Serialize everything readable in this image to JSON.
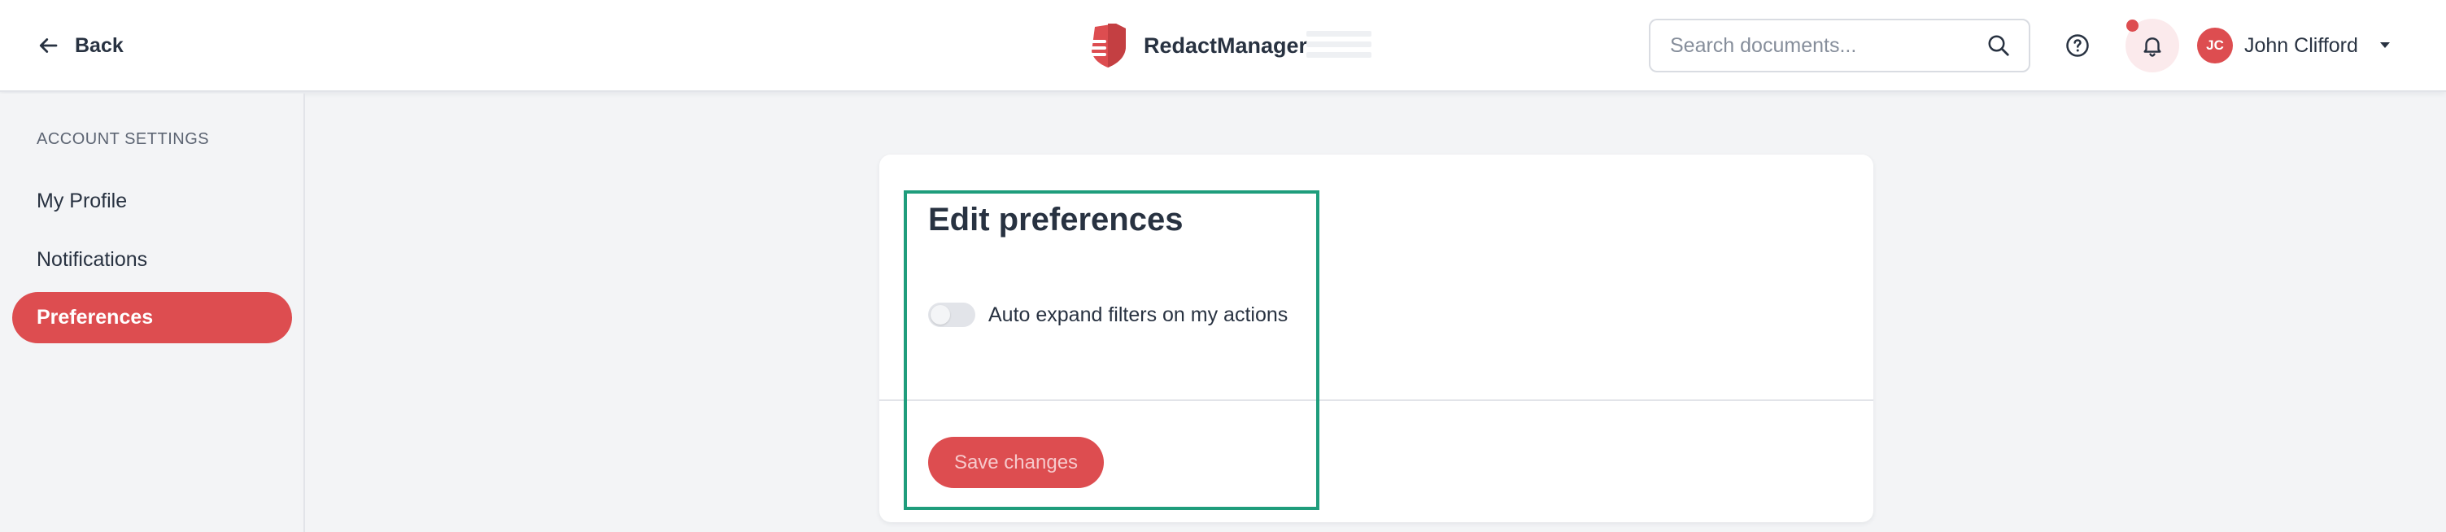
{
  "colors": {
    "accent": "#dd4d50",
    "text": "#283241",
    "muted": "#5d6573",
    "background": "#f3f4f6",
    "highlight": "#1f9d7c"
  },
  "header": {
    "back_label": "Back",
    "back_icon": "arrow-left-icon",
    "brand_name": "RedactManager",
    "brand_icon": "shield-logo-icon",
    "search": {
      "placeholder": "Search documents...",
      "value": "",
      "icon": "search-icon"
    },
    "help_icon": "help-circle-icon",
    "notifications_icon": "bell-icon",
    "user": {
      "initials": "JC",
      "name": "John Clifford",
      "menu_icon": "caret-down-icon"
    }
  },
  "sidebar": {
    "heading": "ACCOUNT SETTINGS",
    "items": [
      {
        "label": "My Profile",
        "active": false
      },
      {
        "label": "Notifications",
        "active": false
      },
      {
        "label": "Preferences",
        "active": true
      }
    ]
  },
  "main": {
    "title": "Edit preferences",
    "preferences": [
      {
        "label": "Auto expand filters on my actions",
        "enabled": false
      }
    ],
    "save_label": "Save changes"
  }
}
